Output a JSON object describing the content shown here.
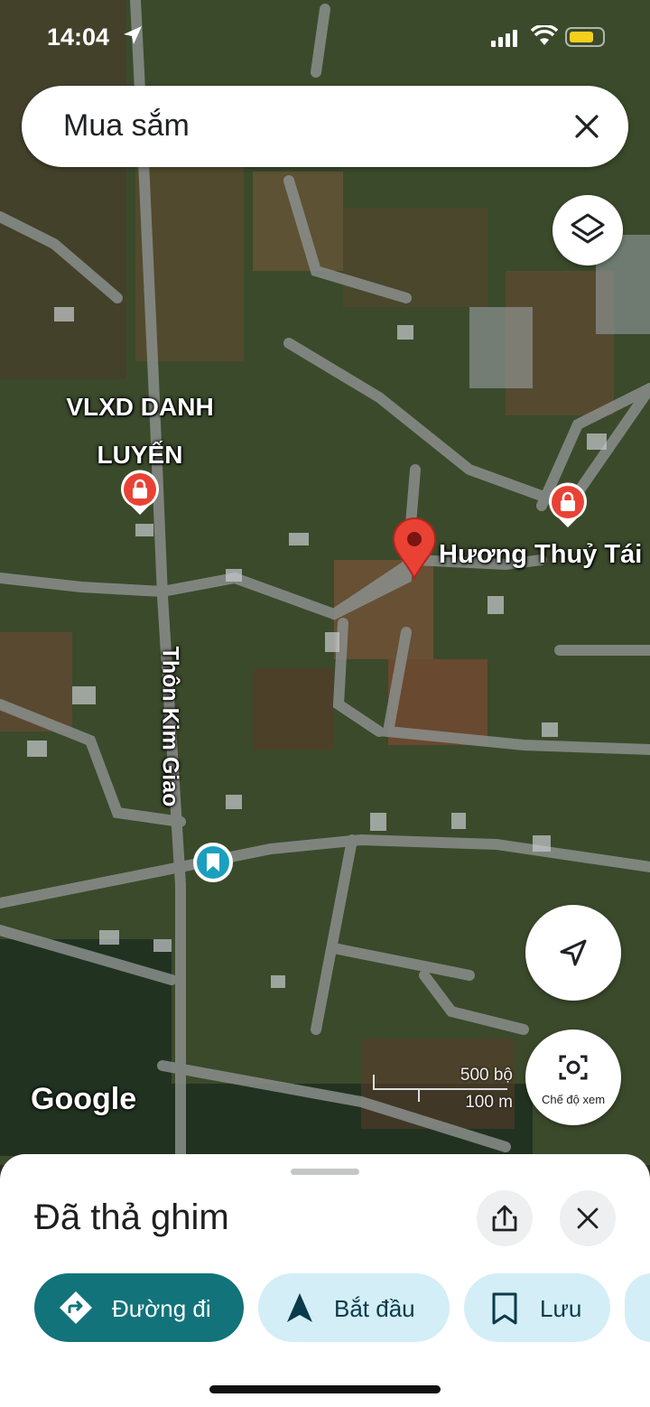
{
  "status_bar": {
    "time": "14:04",
    "battery_color": "#f5cf1b"
  },
  "search": {
    "query": "Mua sắm"
  },
  "map": {
    "places": [
      {
        "name": "VLXD DANH\nLUYẾN",
        "icon": "shopping-bag-icon"
      },
      {
        "name": "Hương Thuỷ Tái",
        "icon": "dropped-pin-icon"
      }
    ],
    "road_label": "Thôn Kim Giao",
    "attribution": "Google",
    "scale": {
      "imperial": "500 bộ",
      "metric": "100 m"
    },
    "view_mode_label": "Chế độ xem",
    "pin_color": "#e94235",
    "shop_marker_color": "#e94235",
    "saved_marker_color": "#1a9fbf"
  },
  "sheet": {
    "title": "Đã thả ghim",
    "chips": [
      {
        "label": "Đường đi",
        "icon": "directions-icon"
      },
      {
        "label": "Bắt đầu",
        "icon": "navigation-arrow-icon"
      },
      {
        "label": "Lưu",
        "icon": "bookmark-icon"
      }
    ],
    "accent": "#12737a"
  }
}
